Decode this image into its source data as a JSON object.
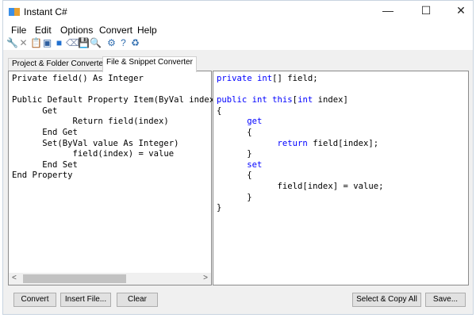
{
  "window": {
    "title": "Instant C#",
    "minimize": "—",
    "maximize": "☐",
    "close": "✕"
  },
  "menu": [
    {
      "label": "File",
      "key": "F"
    },
    {
      "label": "Edit",
      "key": "E"
    },
    {
      "label": "Options",
      "key": "O"
    },
    {
      "label": "Convert",
      "key": "C"
    },
    {
      "label": "Help",
      "key": "H"
    }
  ],
  "toolbar": [
    {
      "name": "wrench-icon",
      "glyph": "🔧",
      "color": "#c03030"
    },
    {
      "name": "delete-icon",
      "glyph": "✕",
      "color": "#888"
    },
    {
      "name": "paste-icon",
      "glyph": "📋",
      "color": "#c09030"
    },
    {
      "name": "window-icon",
      "glyph": "▣",
      "color": "#3060a0"
    },
    {
      "name": "square-icon",
      "glyph": "■",
      "color": "#2070d0"
    },
    {
      "name": "eraser-icon",
      "glyph": "⌫",
      "color": "#8090b0"
    },
    {
      "name": "save-icon",
      "glyph": "💾",
      "color": "#2050a0"
    },
    {
      "name": "find-icon",
      "glyph": "🔍",
      "color": "#c09030"
    },
    {
      "name": "settings-icon",
      "glyph": "⚙",
      "color": "#2f6db0"
    },
    {
      "name": "help-icon",
      "glyph": "?",
      "color": "#2f6db0"
    },
    {
      "name": "refresh-icon",
      "glyph": "♻",
      "color": "#2f6db0"
    }
  ],
  "tabs": [
    {
      "label": "Project & Folder Converter"
    },
    {
      "label": "File & Snippet Converter"
    }
  ],
  "source_code": "Private field() As Integer\n\nPublic Default Property Item(ByVal index\n      Get\n            Return field(index)\n      End Get\n      Set(ByVal value As Integer)\n            field(index) = value\n      End Set\nEnd Property",
  "output_code": [
    [
      "kw",
      "private int"
    ],
    [
      "",
      "[] field;\n\n"
    ],
    [
      "kw",
      "public int this"
    ],
    [
      "",
      "["
    ],
    [
      "kw",
      "int"
    ],
    [
      "",
      " index]\n{\n      "
    ],
    [
      "kw",
      "get"
    ],
    [
      "",
      "\n      {\n            "
    ],
    [
      "kw",
      "return"
    ],
    [
      "",
      " field[index];\n      }\n      "
    ],
    [
      "kw",
      "set"
    ],
    [
      "",
      "\n      {\n            field[index] = value;\n      }\n}"
    ]
  ],
  "buttons": {
    "convert": "Convert",
    "insert_file": "Insert File...",
    "clear": "Clear",
    "select_copy_all": "Select & Copy All",
    "save": "Save..."
  }
}
